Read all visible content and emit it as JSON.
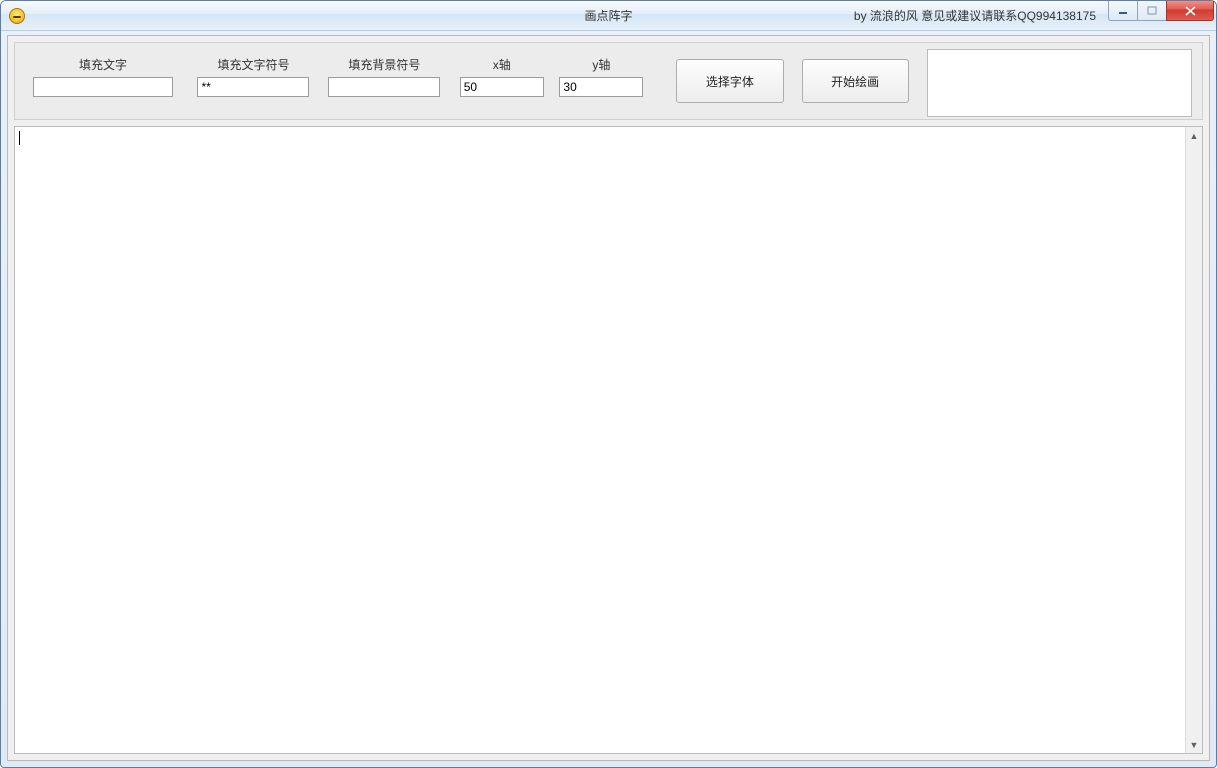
{
  "window": {
    "title_center": "画点阵字",
    "title_right": "by 流浪的风 意见或建议请联系QQ994138175"
  },
  "toolbar": {
    "fill_text": {
      "label": "填充文字",
      "value": ""
    },
    "fill_char": {
      "label": "填充文字符号",
      "value": "**"
    },
    "fill_bg": {
      "label": "填充背景符号",
      "value": ""
    },
    "x_axis": {
      "label": "x轴",
      "value": "50"
    },
    "y_axis": {
      "label": "y轴",
      "value": "30"
    },
    "choose_font_label": "选择字体",
    "start_draw_label": "开始绘画"
  },
  "canvas": {
    "content": ""
  }
}
